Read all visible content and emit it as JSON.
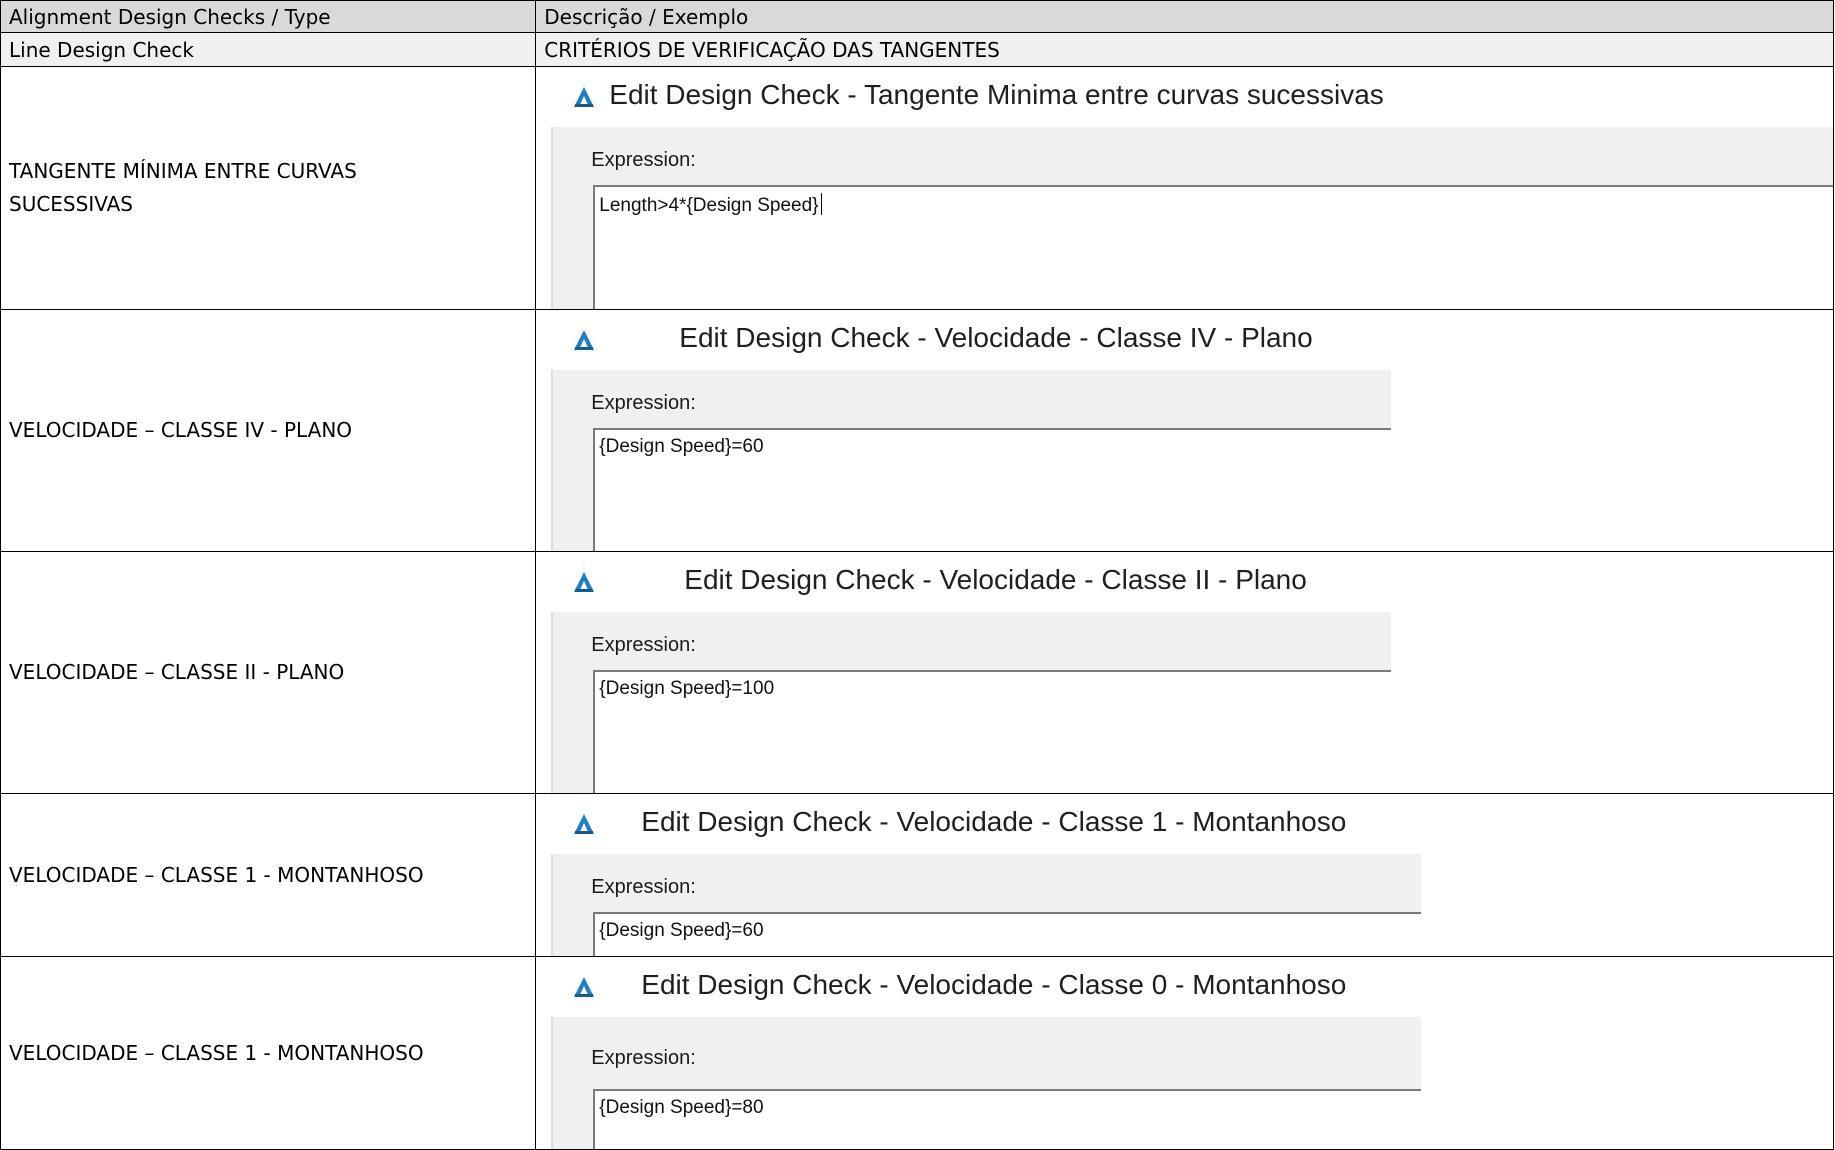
{
  "header": {
    "col_type": "Alignment Design Checks / Type",
    "col_desc": "Descrição / Exemplo"
  },
  "section": {
    "type": "Line Design Check",
    "desc": "CRITÉRIOS DE VERIFICAÇÃO DAS TANGENTES"
  },
  "rows": [
    {
      "type": "TANGENTE MÍNIMA ENTRE CURVAS SUCESSIVAS",
      "dialog_title": "Edit Design Check - Tangente Minima entre curvas sucessivas",
      "expression_label": "Expression:",
      "expression": "Length>4*{Design Speed}"
    },
    {
      "type": "VELOCIDADE – CLASSE IV - PLANO",
      "dialog_title": "Edit Design Check - Velocidade - Classe IV - Plano",
      "expression_label": "Expression:",
      "expression": "{Design Speed}=60"
    },
    {
      "type": "VELOCIDADE – CLASSE II - PLANO",
      "dialog_title": "Edit Design Check - Velocidade - Classe II - Plano",
      "expression_label": "Expression:",
      "expression": "{Design Speed}=100"
    },
    {
      "type": "VELOCIDADE – CLASSE 1 - MONTANHOSO",
      "dialog_title": "Edit Design Check - Velocidade - Classe 1 - Montanhoso",
      "expression_label": "Expression:",
      "expression": "{Design Speed}=60"
    },
    {
      "type": "VELOCIDADE – CLASSE 1 - MONTANHOSO",
      "dialog_title": "Edit Design Check - Velocidade - Classe 0 - Montanhoso",
      "expression_label": "Expression:",
      "expression": "{Design Speed}=80"
    }
  ],
  "colors": {
    "header_bg": "#d9d9d9",
    "dialog_body_bg": "#f0f0f0",
    "app_icon": "#1e7fc2"
  }
}
